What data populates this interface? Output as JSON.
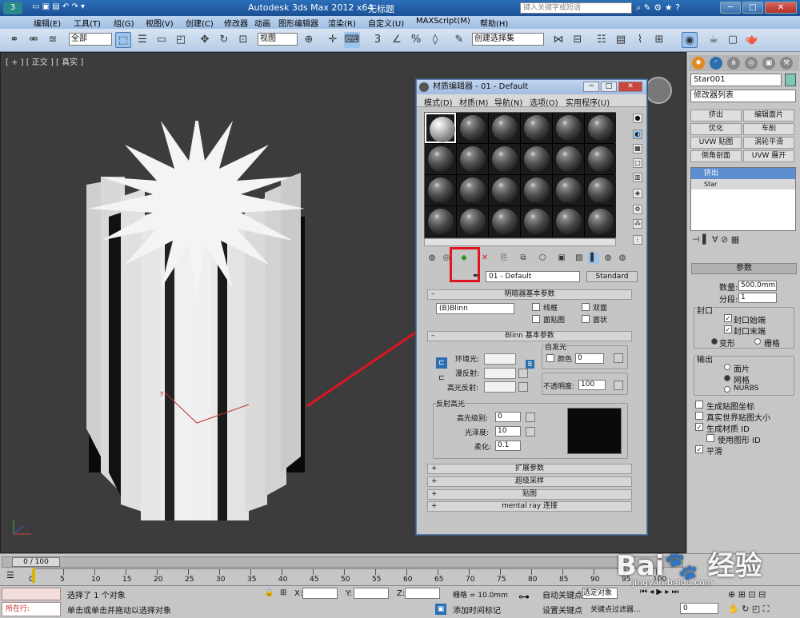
{
  "app": {
    "title": "Autodesk 3ds Max  2012 x64",
    "doc_title": "无标题",
    "search_placeholder": "键入关键字或短语"
  },
  "menu": [
    "编辑(E)",
    "工具(T)",
    "组(G)",
    "视图(V)",
    "创建(C)",
    "修改器",
    "动画",
    "图形编辑器",
    "渲染(R)",
    "自定义(U)",
    "MAXScript(M)",
    "帮助(H)"
  ],
  "toolbar": {
    "selection_filter": "全部",
    "ref_coord": "视图",
    "named_selection": "创建选择集"
  },
  "viewport": {
    "label": "[ + ] [ 正交 ] [ 真实 ]"
  },
  "cmd_panel": {
    "object_name": "Star001",
    "modifier_list": "修改器列表",
    "buttons": [
      "挤出",
      "编辑面片",
      "优化",
      "车削",
      "UVW 贴图",
      "涡轮平滑",
      "倒角剖面",
      "UVW 展开"
    ],
    "stack_items": [
      "挤出",
      "Star"
    ],
    "params_title": "参数",
    "amount_label": "数量:",
    "amount_value": "500.0mm",
    "segments_label": "分段:",
    "segments_value": "1",
    "capping_title": "封口",
    "cap_start": "封口始端",
    "cap_end": "封口末端",
    "morph": "变形",
    "grid": "栅格",
    "output_title": "输出",
    "patch": "面片",
    "mesh": "网格",
    "nurbs": "NURBS",
    "gen_mapping": "生成贴图坐标",
    "real_world": "真实世界贴图大小",
    "gen_matid": "生成材质 ID",
    "use_shape_id": "使用图形 ID",
    "smooth": "平滑"
  },
  "material_editor": {
    "title": "材质编辑器 - 01 - Default",
    "menu": [
      "模式(D)",
      "材质(M)",
      "导航(N)",
      "选项(O)",
      "实用程序(U)"
    ],
    "material_name": "01 - Default",
    "material_type": "Standard",
    "shader_basic_title": "明暗器基本参数",
    "shader": "(B)Blinn",
    "wire": "线框",
    "two_sided": "双面",
    "face_map": "面贴图",
    "faceted": "面状",
    "blinn_title": "Blinn 基本参数",
    "self_illum": "自发光",
    "color_label": "颜色",
    "color_value": "0",
    "ambient": "环境光:",
    "diffuse": "漫反射:",
    "specular": "高光反射:",
    "opacity_label": "不透明度:",
    "opacity_value": "100",
    "spec_highlights": "反射高光",
    "spec_level_label": "高光级别:",
    "spec_level_value": "0",
    "glossiness_label": "光泽度:",
    "glossiness_value": "10",
    "soften_label": "柔化:",
    "soften_value": "0.1",
    "rollouts": [
      "扩展参数",
      "超级采样",
      "贴图",
      "mental ray 连接"
    ]
  },
  "timeline": {
    "frame_display": "0 / 100",
    "ticks": [
      "0",
      "5",
      "10",
      "15",
      "20",
      "25",
      "30",
      "35",
      "40",
      "45",
      "50",
      "55",
      "60",
      "65",
      "70",
      "75",
      "80",
      "85",
      "90",
      "95",
      "100"
    ]
  },
  "status": {
    "selected": "选择了 1 个对象",
    "prompt": "单击或单击并拖动以选择对象",
    "running_label": "所在行:",
    "x_label": "X:",
    "y_label": "Y:",
    "z_label": "Z:",
    "grid": "栅格 = 10.0mm",
    "add_time_tag": "添加时间标记",
    "auto_key": "自动关键点",
    "set_key": "设置关键点",
    "selected_obj": "选定对象",
    "key_filters": "关键点过滤器...",
    "frame": "0"
  },
  "watermark": "Baidu经验 jingyan.baidu.com",
  "colors": {
    "accent_red": "#e0141e",
    "title_blue": "#1b4f93"
  }
}
